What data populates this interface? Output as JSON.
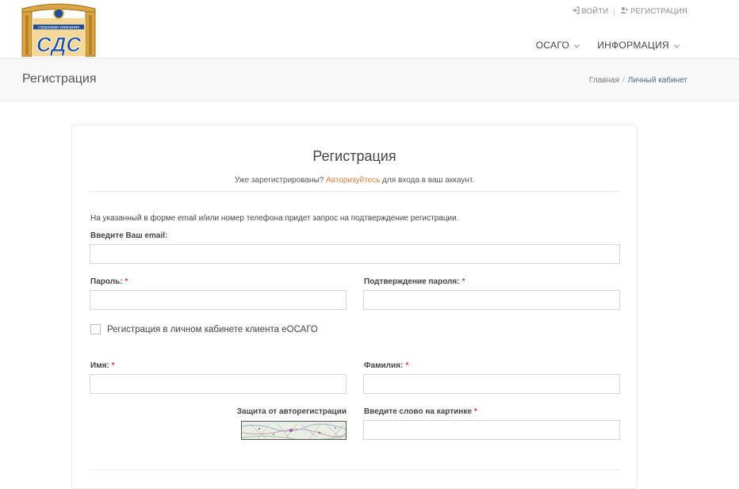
{
  "header": {
    "logo_text": "СДС",
    "logo_subtext": "страховая компания",
    "top_links": {
      "login_label": "ВОЙТИ",
      "register_label": "РЕГИСТРАЦИЯ"
    },
    "nav": [
      {
        "label": "ОСАГО"
      },
      {
        "label": "ИНФОРМАЦИЯ"
      }
    ]
  },
  "titlebar": {
    "title": "Регистрация",
    "breadcrumb": [
      "Главная",
      "Личный кабинет"
    ]
  },
  "form": {
    "title": "Регистрация",
    "subtitle_before": "Уже зарегистрированы?",
    "subtitle_link": "Авторизуйтесь",
    "subtitle_after": "для входа в ваш аккаунт.",
    "notice": "На указанный в форме email и/или номер телефона придет запрос на подтверждение регистрации.",
    "email_label": "Введите Ваш email:",
    "email_value": "",
    "password_label": "Пароль:",
    "password_value": "",
    "confirm_label": "Подтверждение пароля:",
    "confirm_value": "",
    "checkbox_label": "Регистрация в личном кабинете клиента еОСАГО",
    "checkbox_checked": false,
    "name_label": "Имя:",
    "name_value": "",
    "surname_label": "Фамилия:",
    "surname_value": "",
    "captcha_label": "Защита от авторегистрации",
    "captcha_input_label": "Введите слово на картинке",
    "captcha_value": "",
    "required_mark": "*"
  },
  "colors": {
    "link": "#d8813e",
    "required": "#d9363e",
    "logo_blue": "#1f4f9c",
    "logo_gold": "#d9a441"
  },
  "icons": {
    "login": "sign-in-icon",
    "register": "user-plus-icon",
    "dropdown": "chevron-down-icon"
  }
}
